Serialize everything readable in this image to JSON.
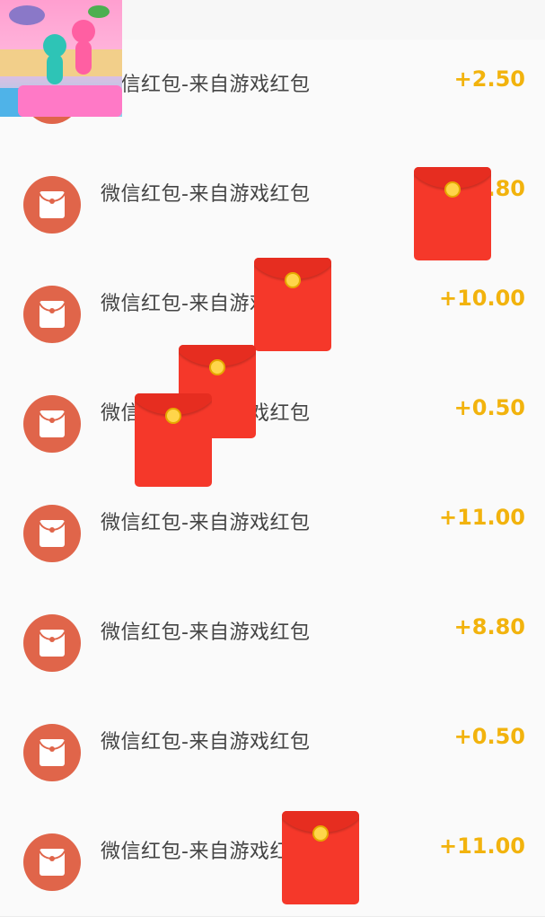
{
  "records": [
    {
      "title": "微信红包-来自游戏红包",
      "amount": "+2.50"
    },
    {
      "title": "微信红包-来自游戏红包",
      "amount": "+...80"
    },
    {
      "title": "微信红包-来自游戏红包",
      "amount": "+10.00"
    },
    {
      "title": "微信红包-来自游戏红包",
      "amount": "+0.50"
    },
    {
      "title": "微信红包-来自游戏红包",
      "amount": "+11.00"
    },
    {
      "title": "微信红包-来自游戏红包",
      "amount": "+8.80"
    },
    {
      "title": "微信红包-来自游戏红包",
      "amount": "+0.50"
    },
    {
      "title": "微信红包-来自游戏红包",
      "amount": "+11.00"
    }
  ],
  "icons": {
    "row_icon": "red-envelope-icon",
    "overlay": "red-packet-icon",
    "thumbnail": "game-thumbnail"
  },
  "colors": {
    "amount": "#f2b30d",
    "avatar": "#e0654a",
    "packet": "#f5382a"
  }
}
